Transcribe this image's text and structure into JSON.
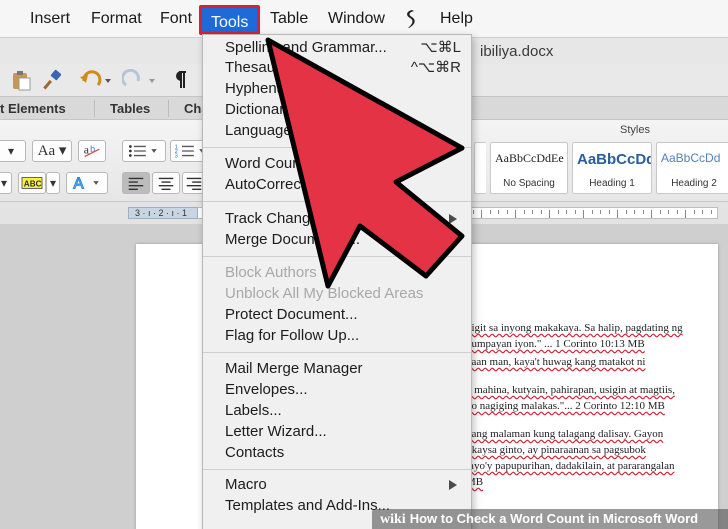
{
  "menubar": {
    "items": [
      "Insert",
      "Format",
      "Font",
      "Tools",
      "Table",
      "Window",
      "Help"
    ],
    "active": "Tools"
  },
  "window": {
    "doc_title": "ibiliya.docx"
  },
  "ribbon_tabs": [
    "t Elements",
    "Tables",
    "Cha"
  ],
  "ribbon": {
    "styles_label": "Styles",
    "styles": [
      {
        "sample": "AaBbCcDdEe",
        "name": "No Spacing"
      },
      {
        "sample": "AaBbCcDd",
        "name": "Heading 1"
      },
      {
        "sample": "AaBbCcDd",
        "name": "Heading 2"
      }
    ],
    "ruler_text": "3 · ı · 2 · ı · 1"
  },
  "tools_menu": {
    "groups": [
      [
        {
          "label": "Spelling and Grammar...",
          "shortcut": "⌥⌘L"
        },
        {
          "label": "Thesaurus...",
          "shortcut": "^⌥⌘R"
        },
        {
          "label": "Hyphenation..."
        },
        {
          "label": "Dictionary..."
        },
        {
          "label": "Language..."
        }
      ],
      [
        {
          "label": "Word Count..."
        },
        {
          "label": "AutoCorrect..."
        }
      ],
      [
        {
          "label": "Track Changes",
          "submenu": true
        },
        {
          "label": "Merge Documents..."
        }
      ],
      [
        {
          "label": "Block Authors",
          "disabled": true
        },
        {
          "label": "Unblock All My Blocked Areas",
          "disabled": true
        },
        {
          "label": "Protect Document..."
        },
        {
          "label": "Flag for Follow Up..."
        }
      ],
      [
        {
          "label": "Mail Merge Manager"
        },
        {
          "label": "Envelopes..."
        },
        {
          "label": "Labels..."
        },
        {
          "label": "Letter Wizard..."
        },
        {
          "label": "Contacts"
        }
      ],
      [
        {
          "label": "Macro",
          "submenu": true
        },
        {
          "label": "Templates and Add-Ins..."
        }
      ]
    ]
  },
  "document": {
    "lines": [
      "higit sa inyong makakaya. Sa halip, pagdating ng",
      "gumpayan iyon.\" ... 1 Corinto 10:13 MB",
      "yaan man, kaya't huwag kang matakot ni",
      "y mahina, kutyain, pahirapan, usigin at magtiis,",
      "ko nagiging malakas.\"... 2 Corinto 12:10 MB",
      "pang malaman kung talagang dalisay. Gayon",
      "t kaysa ginto, ay pinaraanan sa pagsubok",
      "tayo'y papupurihan, dadakilain, at pararangalan",
      "MB"
    ]
  },
  "watermark": {
    "brand": "wiki",
    "text": "How to Check a Word Count in Microsoft Word"
  },
  "colors": {
    "menu_highlight": "#1d6ad8",
    "callout_red": "#d6213a",
    "arrow_fill": "#e43345"
  }
}
